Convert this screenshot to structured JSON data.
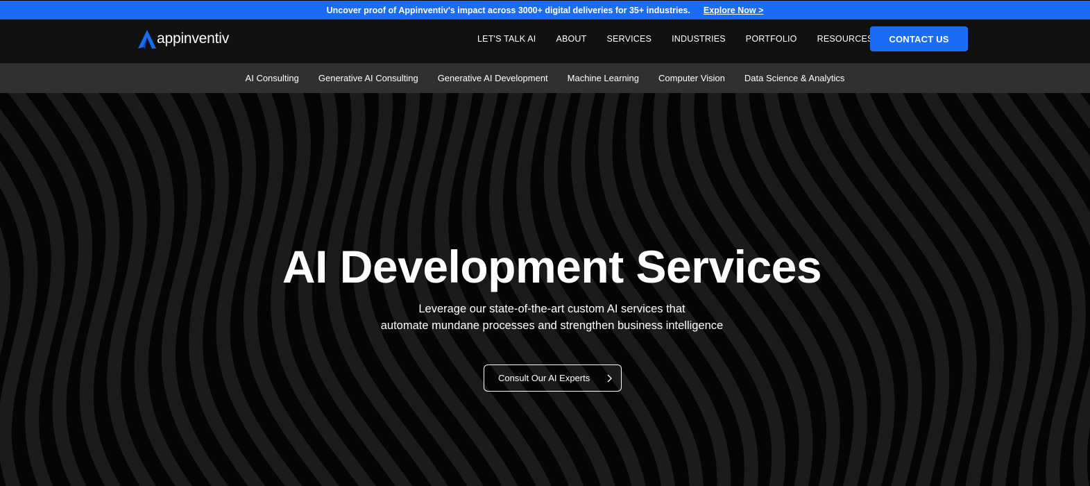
{
  "announcement": {
    "message": "Uncover proof of Appinventiv's impact across 3000+ digital deliveries for 35+ industries.",
    "link_label": "Explore Now >"
  },
  "header": {
    "logo_text": "appinventiv",
    "nav": [
      {
        "label": "LET'S TALK AI"
      },
      {
        "label": "ABOUT"
      },
      {
        "label": "SERVICES"
      },
      {
        "label": "INDUSTRIES"
      },
      {
        "label": "PORTFOLIO"
      },
      {
        "label": "RESOURCES"
      }
    ],
    "contact_label": "CONTACT US"
  },
  "subnav": {
    "items": [
      {
        "label": "AI Consulting"
      },
      {
        "label": "Generative AI Consulting"
      },
      {
        "label": "Generative AI Development"
      },
      {
        "label": "Machine Learning"
      },
      {
        "label": "Computer Vision"
      },
      {
        "label": "Data Science & Analytics"
      }
    ]
  },
  "hero": {
    "title": "AI Development Services",
    "subtitle_line1": "Leverage our state-of-the-art custom AI services that",
    "subtitle_line2": "automate mundane processes and strengthen business intelligence",
    "cta_label": "Consult Our AI Experts"
  },
  "icons": {
    "logo": "appinventiv-logo-icon",
    "cta": "chevron-right-icon"
  },
  "colors": {
    "accent": "#1a6cf5",
    "header_bg": "#111111",
    "subnav_bg": "#303030",
    "hero_bg": "#050505"
  }
}
